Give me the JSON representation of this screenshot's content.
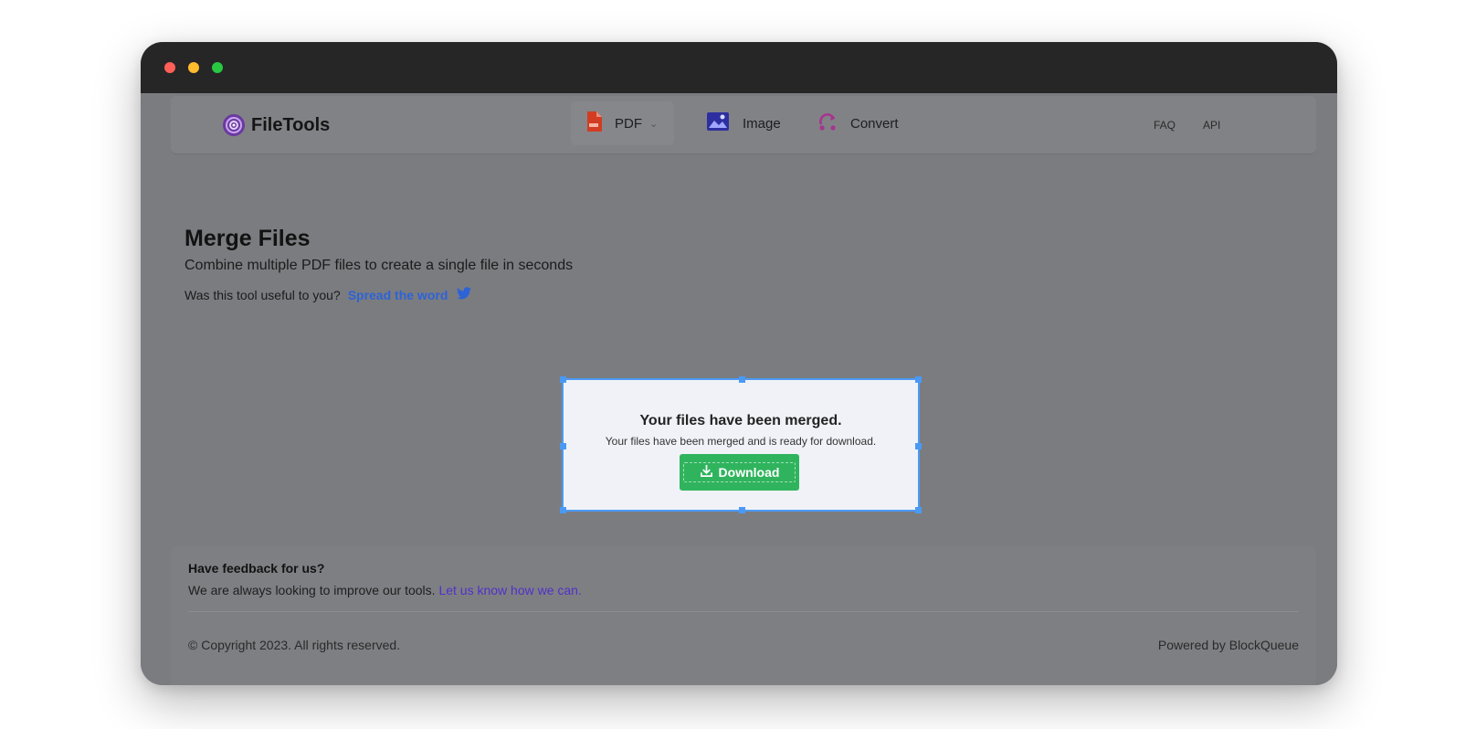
{
  "app": {
    "logo_text": "FileTools"
  },
  "nav": {
    "tabs": [
      {
        "label": "PDF",
        "icon": "pdf-file-icon",
        "active": true
      },
      {
        "label": "Image",
        "icon": "image-icon",
        "active": false
      },
      {
        "label": "Convert",
        "icon": "convert-icon",
        "active": false
      }
    ],
    "links": [
      "FAQ",
      "API"
    ]
  },
  "main": {
    "title": "Merge Files",
    "subtitle": "Combine multiple PDF files to create a single file in seconds",
    "useful_prompt": "Was this tool useful to you?",
    "spread_link": "Spread the word"
  },
  "dialog": {
    "title": "Your files have been merged.",
    "message": "Your files have been merged and is ready for download.",
    "download_label": "Download"
  },
  "footer": {
    "feedback_title": "Have feedback for us?",
    "feedback_text": "We are always looking to improve our tools.",
    "feedback_link": "Let us know how we can.",
    "copyright": "© Copyright 2023. All rights reserved.",
    "powered_by": "Powered by BlockQueue"
  },
  "colors": {
    "overlay": "#7b7c80",
    "titlebar": "#262626",
    "accent_blue": "#4a9af5",
    "download_green": "#2fb45d",
    "link_blue": "#2d63d6",
    "link_purple": "#5230c9"
  }
}
